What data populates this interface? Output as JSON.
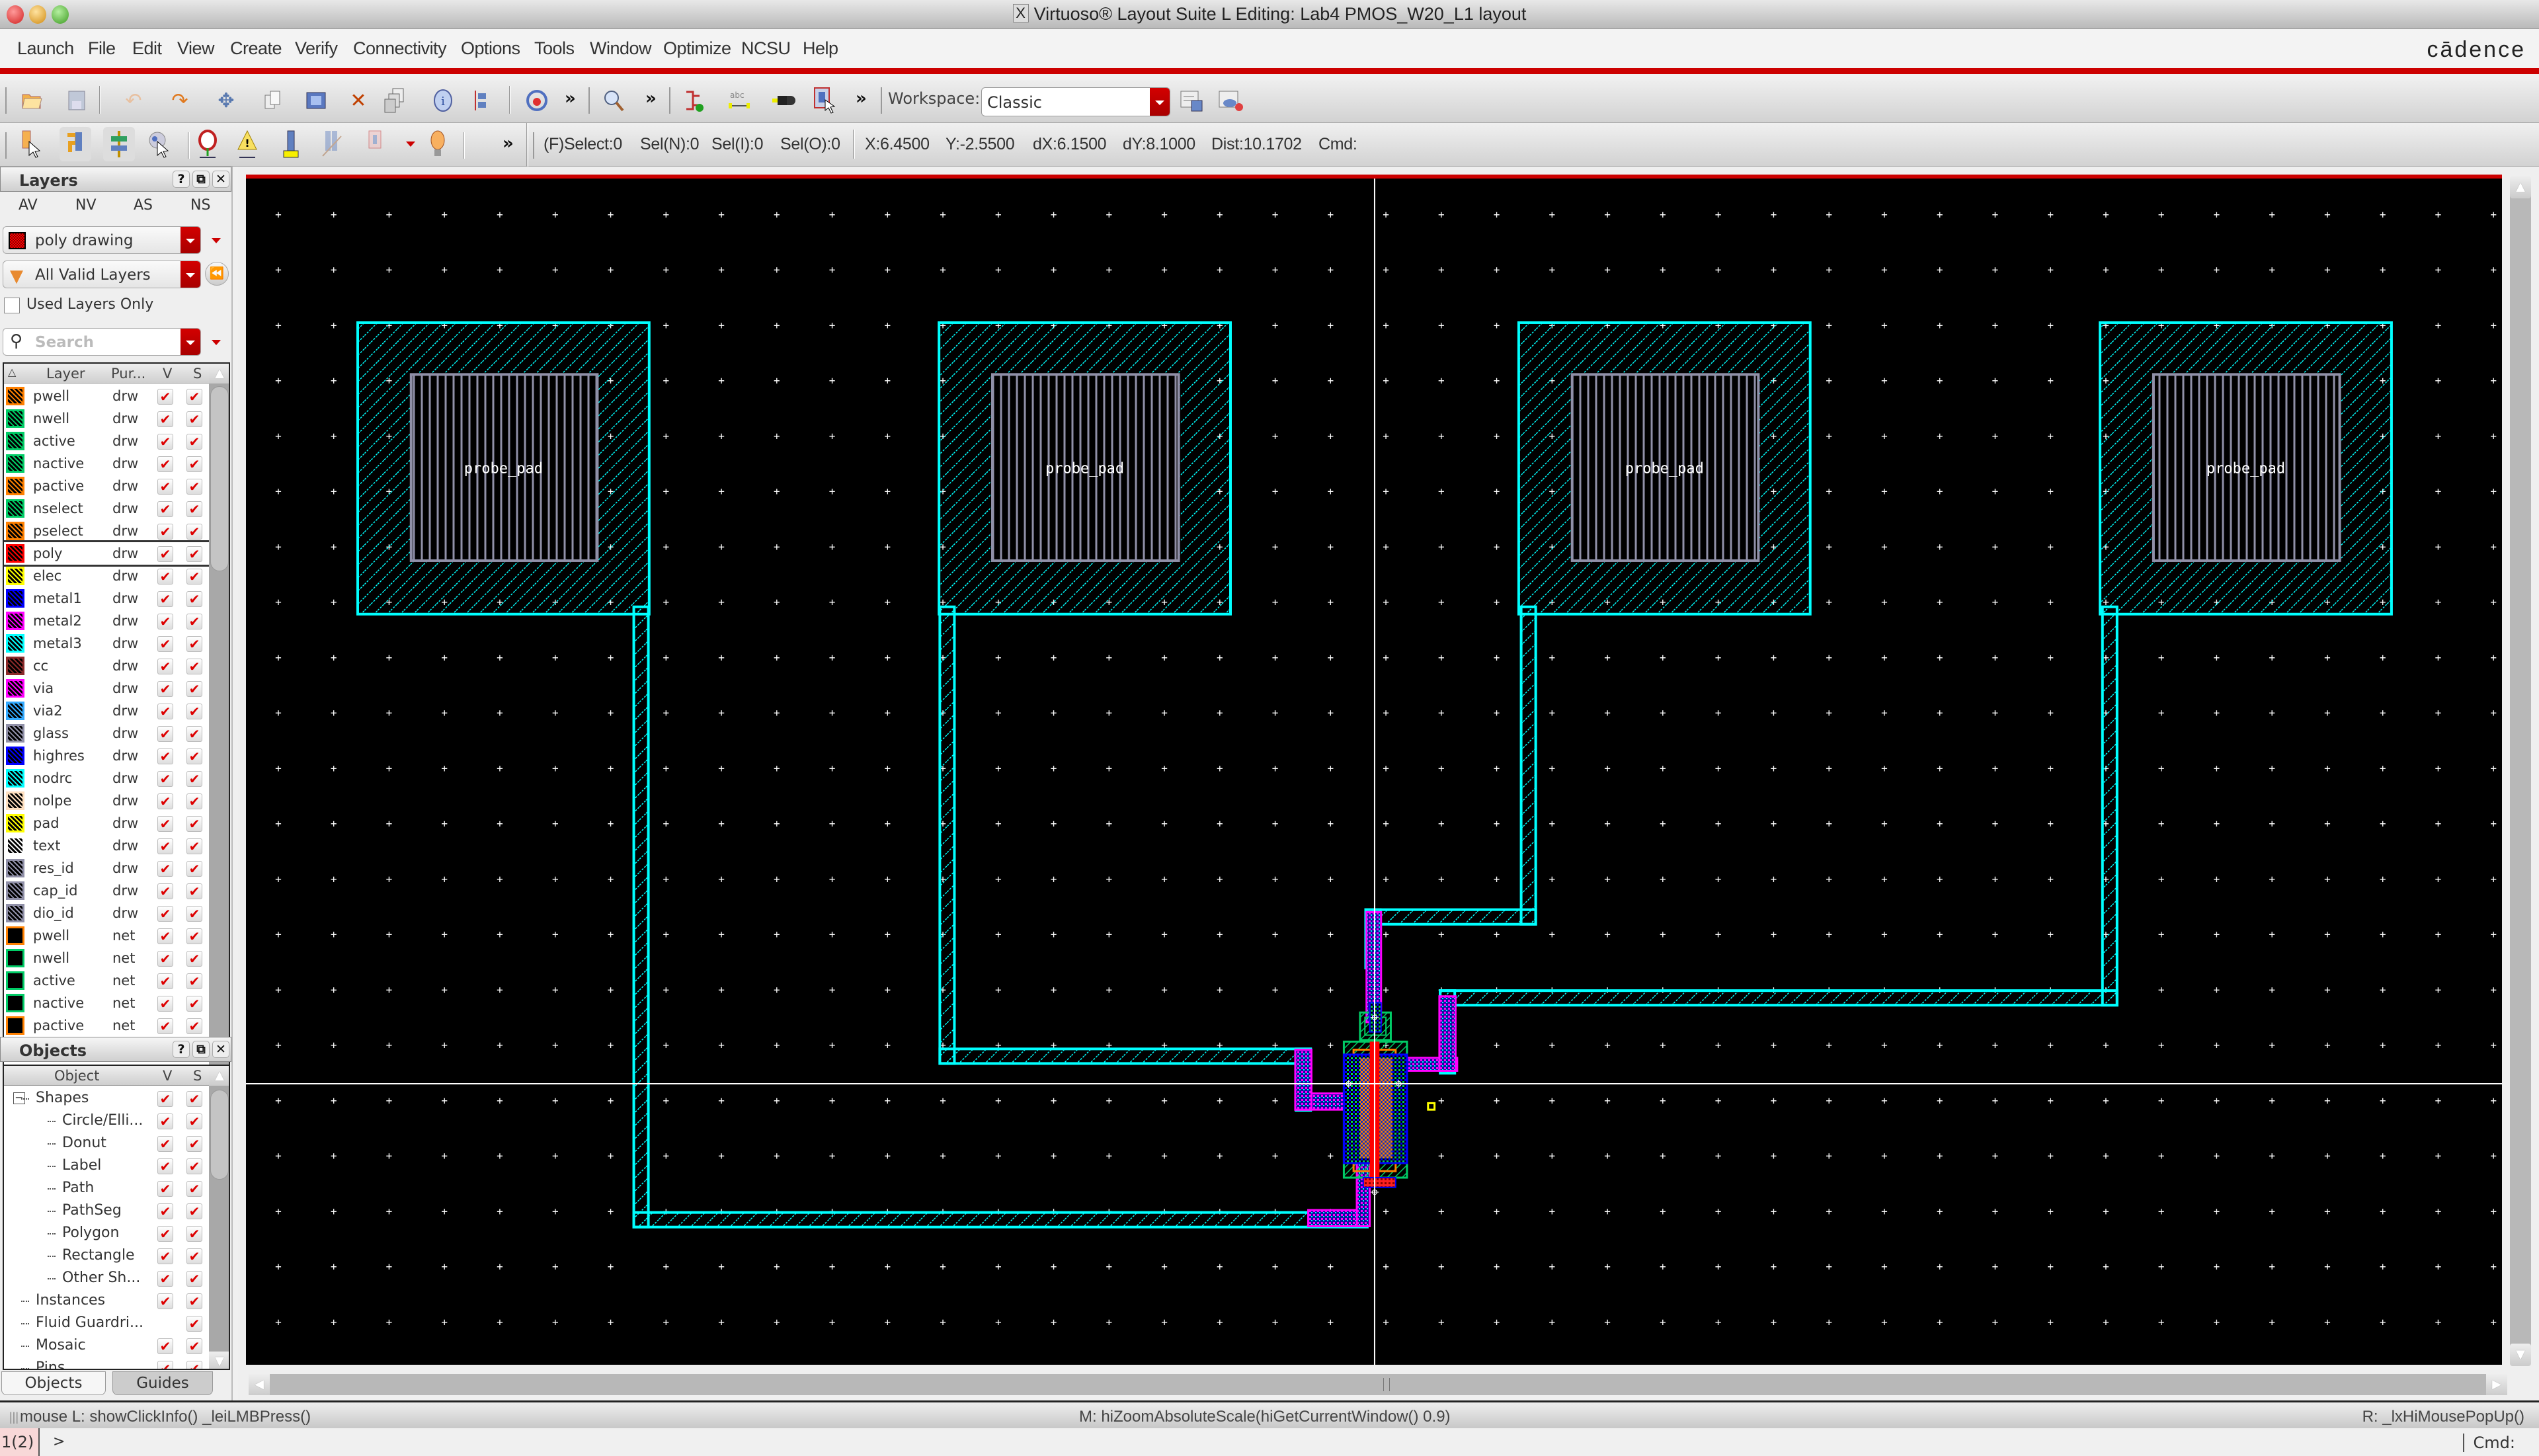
{
  "window": {
    "title": "Virtuoso® Layout Suite L Editing: Lab4 PMOS_W20_L1 layout",
    "x_icon": "X"
  },
  "menubar": {
    "items": [
      "Launch",
      "File",
      "Edit",
      "View",
      "Create",
      "Verify",
      "Connectivity",
      "Options",
      "Tools",
      "Window",
      "Optimize",
      "NCSU",
      "Help"
    ],
    "logo": "cādence"
  },
  "toolbar1": {
    "icons": [
      "open-folder-icon",
      "save-icon",
      "undo-icon",
      "redo-icon",
      "move-icon",
      "copy-icon",
      "stretch-icon",
      "delete-icon",
      "properties-icon",
      "info-icon",
      "align-icon",
      "tools-icon",
      "zoom-icon",
      "create-inst-icon",
      "create-label-icon",
      "create-pin-icon",
      "select-icon"
    ],
    "overflow": "»",
    "workspace_label": "Workspace:",
    "workspace_value": "Classic"
  },
  "toolbar2": {
    "overflow": "»",
    "status": {
      "select": "(F)Select:0",
      "sel_n": "Sel(N):0",
      "sel_i": "Sel(I):0",
      "sel_o": "Sel(O):0",
      "x": "X:6.4500",
      "y": "Y:-2.5500",
      "dx": "dX:6.1500",
      "dy": "dY:8.1000",
      "dist": "Dist:10.1702",
      "cmd": "Cmd:"
    }
  },
  "layers_panel": {
    "title": "Layers",
    "filters": [
      "AV",
      "NV",
      "AS",
      "NS"
    ],
    "current_layer": "poly drawing",
    "filter_value": "All Valid Layers",
    "used_layers_only": "Used Layers Only",
    "used_layers_checked": false,
    "search_placeholder": "Search",
    "columns": [
      "Layer",
      "Pur...",
      "V",
      "S"
    ],
    "rows": [
      {
        "name": "pwell",
        "purpose": "drw",
        "color": "#ff8000",
        "v": true,
        "s": true
      },
      {
        "name": "nwell",
        "purpose": "drw",
        "color": "#00cc66",
        "v": true,
        "s": true
      },
      {
        "name": "active",
        "purpose": "drw",
        "color": "#00cc66",
        "v": true,
        "s": true
      },
      {
        "name": "nactive",
        "purpose": "drw",
        "color": "#00cc66",
        "v": true,
        "s": true
      },
      {
        "name": "pactive",
        "purpose": "drw",
        "color": "#ff8000",
        "v": true,
        "s": true
      },
      {
        "name": "nselect",
        "purpose": "drw",
        "color": "#00cc66",
        "v": true,
        "s": true
      },
      {
        "name": "pselect",
        "purpose": "drw",
        "color": "#ff8000",
        "v": true,
        "s": true
      },
      {
        "name": "poly",
        "purpose": "drw",
        "color": "#ff0000",
        "v": true,
        "s": true,
        "selected": true
      },
      {
        "name": "elec",
        "purpose": "drw",
        "color": "#ffff00",
        "v": true,
        "s": true
      },
      {
        "name": "metal1",
        "purpose": "drw",
        "color": "#0000ff",
        "v": true,
        "s": true
      },
      {
        "name": "metal2",
        "purpose": "drw",
        "color": "#ff00ff",
        "v": true,
        "s": true
      },
      {
        "name": "metal3",
        "purpose": "drw",
        "color": "#00ffff",
        "v": true,
        "s": true
      },
      {
        "name": "cc",
        "purpose": "drw",
        "color": "#8b2a2a",
        "v": true,
        "s": true
      },
      {
        "name": "via",
        "purpose": "drw",
        "color": "#ff00ff",
        "v": true,
        "s": true
      },
      {
        "name": "via2",
        "purpose": "drw",
        "color": "#33aaff",
        "v": true,
        "s": true
      },
      {
        "name": "glass",
        "purpose": "drw",
        "color": "#9090a8",
        "v": true,
        "s": true
      },
      {
        "name": "highres",
        "purpose": "drw",
        "color": "#0000ff",
        "v": true,
        "s": true
      },
      {
        "name": "nodrc",
        "purpose": "drw",
        "color": "#00ffff",
        "v": true,
        "s": true
      },
      {
        "name": "nolpe",
        "purpose": "drw",
        "color": "#ffe0c0",
        "v": true,
        "s": true
      },
      {
        "name": "pad",
        "purpose": "drw",
        "color": "#ffff00",
        "v": true,
        "s": true
      },
      {
        "name": "text",
        "purpose": "drw",
        "color": "#ffffff",
        "v": true,
        "s": true
      },
      {
        "name": "res_id",
        "purpose": "drw",
        "color": "#9090a8",
        "v": true,
        "s": true
      },
      {
        "name": "cap_id",
        "purpose": "drw",
        "color": "#9090a8",
        "v": true,
        "s": true
      },
      {
        "name": "dio_id",
        "purpose": "drw",
        "color": "#9090a8",
        "v": true,
        "s": true
      },
      {
        "name": "pwell",
        "purpose": "net",
        "color": "#ff8000",
        "v": true,
        "s": true
      },
      {
        "name": "nwell",
        "purpose": "net",
        "color": "#00cc66",
        "v": true,
        "s": true
      },
      {
        "name": "active",
        "purpose": "net",
        "color": "#00cc66",
        "v": true,
        "s": true
      },
      {
        "name": "nactive",
        "purpose": "net",
        "color": "#00cc66",
        "v": true,
        "s": true
      },
      {
        "name": "pactive",
        "purpose": "net",
        "color": "#ff8000",
        "v": true,
        "s": true
      }
    ]
  },
  "objects_panel": {
    "title": "Objects",
    "columns": [
      "Object",
      "V",
      "S"
    ],
    "rows": [
      {
        "name": "Shapes",
        "level": 0,
        "expanded": true,
        "v": true,
        "s": true
      },
      {
        "name": "Circle/Elli...",
        "level": 1,
        "v": true,
        "s": true
      },
      {
        "name": "Donut",
        "level": 1,
        "v": true,
        "s": true
      },
      {
        "name": "Label",
        "level": 1,
        "v": true,
        "s": true
      },
      {
        "name": "Path",
        "level": 1,
        "v": true,
        "s": true
      },
      {
        "name": "PathSeg",
        "level": 1,
        "v": true,
        "s": true
      },
      {
        "name": "Polygon",
        "level": 1,
        "v": true,
        "s": true
      },
      {
        "name": "Rectangle",
        "level": 1,
        "v": true,
        "s": true
      },
      {
        "name": "Other Sh...",
        "level": 1,
        "v": true,
        "s": true
      },
      {
        "name": "Instances",
        "level": 0,
        "v": true,
        "s": true
      },
      {
        "name": "Fluid Guardri...",
        "level": 0,
        "v": false,
        "s": true
      },
      {
        "name": "Mosaic",
        "level": 0,
        "v": true,
        "s": true
      },
      {
        "name": "Pins",
        "level": 0,
        "v": true,
        "s": true
      }
    ],
    "tabs": [
      "Objects",
      "Guides"
    ],
    "active_tab": "Objects"
  },
  "canvas": {
    "pads": [
      {
        "label": "probe_pad"
      },
      {
        "label": "probe_pad"
      },
      {
        "label": "probe_pad"
      },
      {
        "label": "probe_pad"
      }
    ],
    "layer_colors": {
      "metal3": "#00ffff",
      "metal2": "#ff00ff",
      "metal1": "#0000ff",
      "glass": "#9090a8",
      "poly": "#ff0000",
      "active": "#00cc66",
      "pselect": "#ff8000",
      "grid": "#ffffff",
      "marker": "#ffff00"
    }
  },
  "statusbar": {
    "mouse_left": "mouse L: showClickInfo() _leiLMBPress()",
    "mouse_middle": "M: hiZoomAbsoluteScale(hiGetCurrentWindow() 0.9)",
    "mouse_right": "R: _lxHiMousePopUp()"
  },
  "cmdline": {
    "counter": "1(2)",
    "prompt": ">",
    "cmd_label": "Cmd:"
  }
}
